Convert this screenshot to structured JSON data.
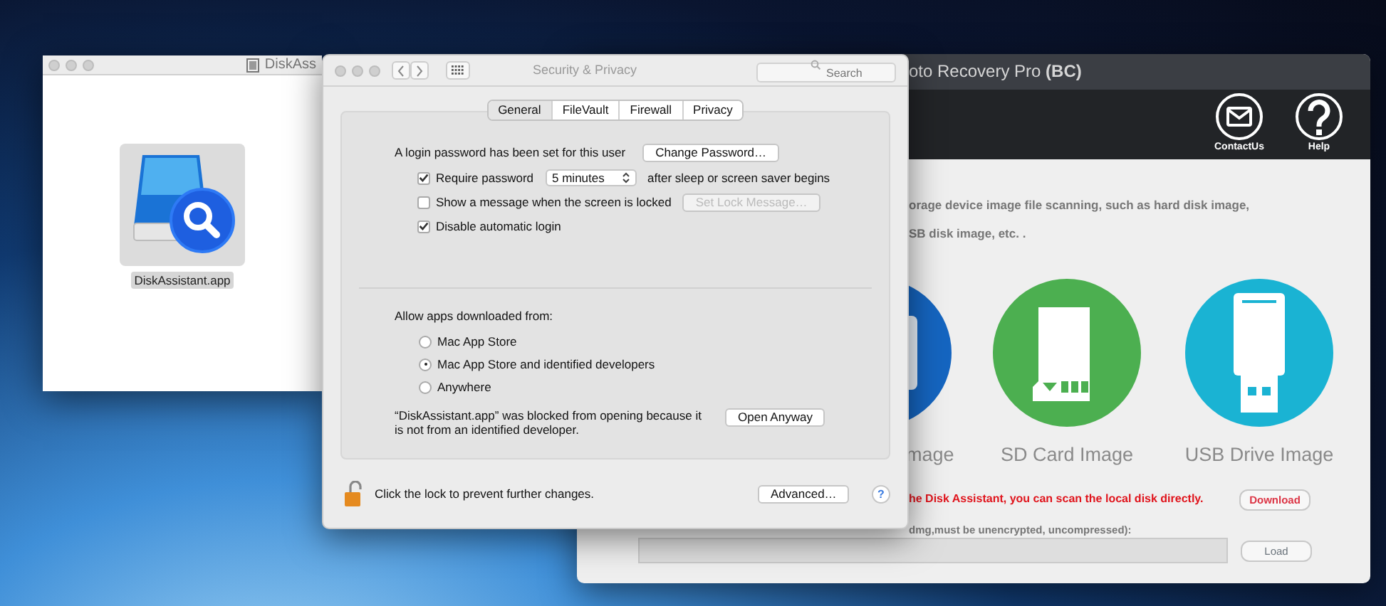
{
  "finder_window": {
    "title": "DiskAss",
    "file": {
      "name": "DiskAssistant.app",
      "selected": true
    }
  },
  "recovery_window": {
    "title": "oto Recovery Pro **(BC)**",
    "toolbar": [
      {
        "label": "ContactUs",
        "kind": "mail"
      },
      {
        "label": "Help",
        "kind": "help"
      }
    ],
    "description": [
      "orage device image file scanning, such as hard disk image,",
      "SB disk image, etc. ."
    ],
    "sources": [
      {
        "label": "mage",
        "kind": "disk",
        "color": "#1565c0"
      },
      {
        "label": "SD Card Image",
        "kind": "sd",
        "color": "#4caf50"
      },
      {
        "label": "USB Drive Image",
        "kind": "usb",
        "color": "#1ab3d3"
      }
    ],
    "notice": "he Disk Assistant, you can scan the local disk directly.",
    "download_button": "Download",
    "image_hint": "dmg,must be unencrypted, uncompressed):",
    "load_button": "Load"
  },
  "prefs_window": {
    "title": "Security & Privacy",
    "search": {
      "placeholder": "Search"
    },
    "tabs": [
      {
        "label": "General",
        "selected": true
      },
      {
        "label": "FileVault",
        "selected": false
      },
      {
        "label": "Firewall",
        "selected": false
      },
      {
        "label": "Privacy",
        "selected": false
      }
    ],
    "login_text": "A login password has been set for this user",
    "change_password_button": "Change Password…",
    "options": [
      {
        "kind": "select",
        "label": "Require password",
        "checked": true,
        "value": "5 minutes",
        "suffix": "after sleep or screen saver begins"
      },
      {
        "kind": "button",
        "label": "Show a message when the screen is locked",
        "checked": false,
        "button": "Set Lock Message…",
        "disabled": true
      },
      {
        "kind": "plain",
        "label": "Disable automatic login",
        "checked": true
      }
    ],
    "allow_label": "Allow apps downloaded from:",
    "radios": [
      {
        "label": "Mac App Store",
        "selected": false
      },
      {
        "label": "Mac App Store and identified developers",
        "selected": true
      },
      {
        "label": "Anywhere",
        "selected": false
      }
    ],
    "blocked_message": "“DiskAssistant.app” was blocked from opening because it is not from an identified developer.",
    "open_anyway_button": "Open Anyway",
    "locked": false,
    "lock_text": "Click the lock to prevent further changes.",
    "advanced_button": "Advanced…",
    "help_label": "?"
  }
}
